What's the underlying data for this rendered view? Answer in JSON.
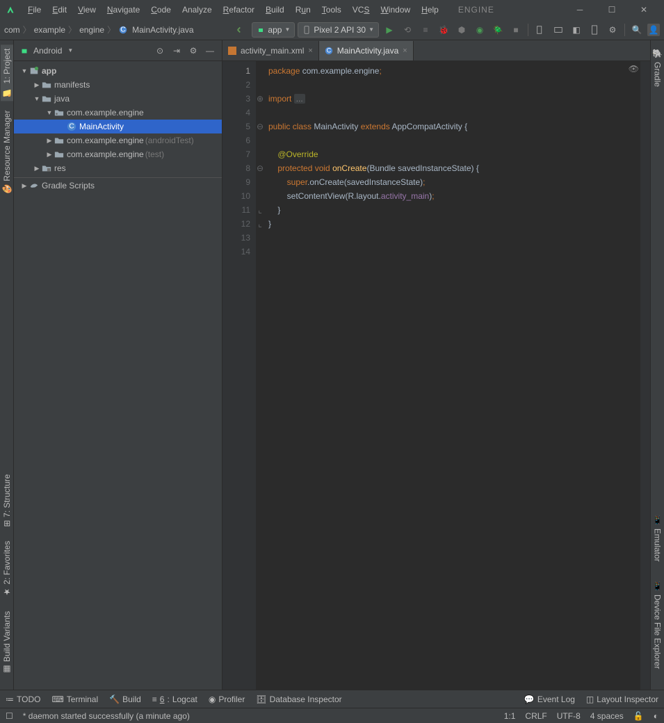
{
  "app_title": "ENGINE",
  "menu": {
    "file": "File",
    "edit": "Edit",
    "view": "View",
    "navigate": "Navigate",
    "code": "Code",
    "analyze": "Analyze",
    "refactor": "Refactor",
    "build": "Build",
    "run": "Run",
    "tools": "Tools",
    "vcs": "VCS",
    "window": "Window",
    "help": "Help"
  },
  "breadcrumb": {
    "p1": "com",
    "p2": "example",
    "p3": "engine",
    "p4": "MainActivity.java"
  },
  "toolbar": {
    "config": "app",
    "device": "Pixel 2 API 30"
  },
  "project": {
    "view": "Android",
    "tree": {
      "app": "app",
      "manifests": "manifests",
      "java": "java",
      "pkg1": "com.example.engine",
      "mainactivity": "MainActivity",
      "pkg2": "com.example.engine",
      "pkg2_suffix": "(androidTest)",
      "pkg3": "com.example.engine",
      "pkg3_suffix": "(test)",
      "res": "res",
      "gradle": "Gradle Scripts"
    }
  },
  "left_rail": {
    "project": "1: Project",
    "resource": "Resource Manager",
    "structure": "7: Structure",
    "favorites": "2: Favorites",
    "buildvar": "Build Variants"
  },
  "right_rail": {
    "gradle": "Gradle",
    "emulator": "Emulator",
    "devexp": "Device File Explorer"
  },
  "tabs": {
    "t1": "activity_main.xml",
    "t2": "MainActivity.java"
  },
  "code": {
    "lines": [
      "1",
      "2",
      "3",
      "4",
      "5",
      "6",
      "7",
      "8",
      "9",
      "10",
      "11",
      "12",
      "13",
      "14"
    ],
    "l1_kw": "package",
    "l1_pkg": " com.example.engine",
    "l3_kw": "import ",
    "l3_fold": "...",
    "l5_kw1": "public ",
    "l5_kw2": "class ",
    "l5_cls": "MainActivity ",
    "l5_kw3": "extends ",
    "l5_sup": "AppCompatActivity {",
    "l7_ann": "@Override",
    "l8_kw1": "protected ",
    "l8_kw2": "void ",
    "l8_fn": "onCreate",
    "l8_par": "(Bundle savedInstanceState) {",
    "l9_kw": "super",
    "l9_rest": ".onCreate(savedInstanceState)",
    "l10": "setContentView(R.layout.",
    "l10_b": "activity_main",
    "l10_c": ")",
    "l11": "}",
    "l12": "}"
  },
  "bottom": {
    "todo": "TODO",
    "terminal": "Terminal",
    "build": "Build",
    "logcat": "6: Logcat",
    "profiler": "Profiler",
    "db": "Database Inspector",
    "eventlog": "Event Log",
    "layout": "Layout Inspector"
  },
  "status": {
    "msg": "* daemon started successfully (a minute ago)",
    "pos": "1:1",
    "lineend": "CRLF",
    "encoding": "UTF-8",
    "indent": "4 spaces"
  }
}
